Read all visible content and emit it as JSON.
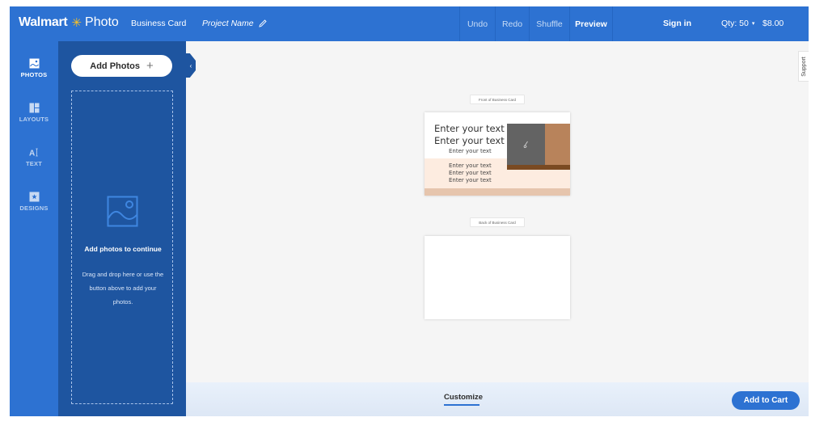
{
  "header": {
    "logo_brand": "Walmart",
    "logo_spark": "✳",
    "logo_product": "Photo",
    "product_type": "Business Card",
    "project_name": "Project Name",
    "toolbar": {
      "undo": "Undo",
      "redo": "Redo",
      "shuffle": "Shuffle",
      "preview": "Preview"
    },
    "sign_in": "Sign in",
    "quantity": "Qty: 50",
    "quantity_caret": "▾",
    "price": "$8.00"
  },
  "rail": {
    "items": [
      {
        "label": "PHOTOS",
        "icon": "photo-icon",
        "active": true
      },
      {
        "label": "LAYOUTS",
        "icon": "layout-icon",
        "active": false
      },
      {
        "label": "TEXT",
        "icon": "text-icon",
        "active": false
      },
      {
        "label": "DESIGNS",
        "icon": "designs-icon",
        "active": false
      }
    ]
  },
  "panel": {
    "add_photos_label": "Add Photos",
    "add_photos_plus": "+",
    "dropzone_title": "Add photos to continue",
    "dropzone_description": "Drag and drop here or use the button above to add your photos.",
    "collapse_glyph": "‹"
  },
  "canvas": {
    "support_label": "Support",
    "front": {
      "label": "Front of Business Card",
      "lines": [
        "Enter your text",
        "Enter your text",
        "Enter your text",
        "Enter your text",
        "Enter your text",
        "Enter your text"
      ]
    },
    "back": {
      "label": "Back of Business Card"
    }
  },
  "bottom": {
    "customize_label": "Customize",
    "add_to_cart_label": "Add to Cart"
  },
  "colors": {
    "brand_blue": "#2d72d2",
    "panel_blue": "#1e55a0",
    "spark_yellow": "#ffc220"
  }
}
